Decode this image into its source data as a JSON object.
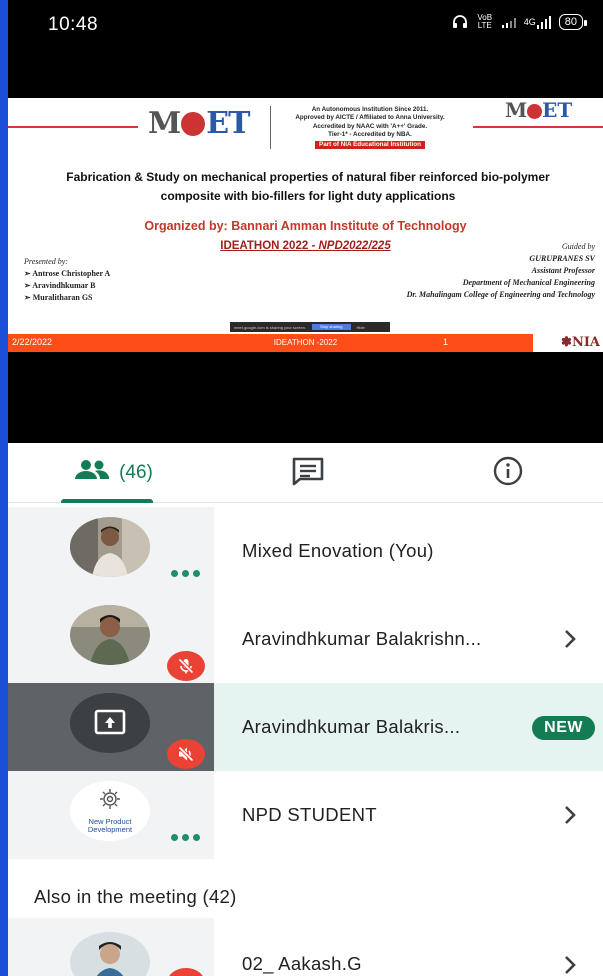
{
  "status_bar": {
    "time": "10:48",
    "icons": [
      "headphones-icon",
      "volte-icon",
      "signal-icon",
      "4g-signal-icon"
    ],
    "volte_text": "VoB LTE",
    "network_text": "4G",
    "battery": "80"
  },
  "slide": {
    "logo_text": "MCET",
    "institution_lines": [
      "An Autonomous Institution Since 2011.",
      "Approved by AICTE / Affiliated to Anna University.",
      "Accredited by NAAC with 'A++' Grade.",
      "Tier-1* - Accredited by NBA."
    ],
    "nia_tag": "Part of NIA Educational Institution",
    "title": "Fabrication & Study on mechanical properties of natural fiber reinforced bio-polymer composite with bio-fillers for light duty applications",
    "organized_by": "Organized by: Bannari Amman Institute of Technology",
    "ideathon_prefix": "IDEATHON 2022 - ",
    "ideathon_code": "NPD2022/225",
    "presented_label": "Presented by:",
    "presenters": [
      "Antrose Christopher A",
      "Aravindhkumar B",
      "Muralitharan GS"
    ],
    "guided_label": "Guided by",
    "guide_name": "GURUPRANES SV",
    "guide_role": "Assistant Professor",
    "guide_dept": "Department of Mechanical Engineering",
    "guide_college": "Dr. Mahalingam College of Engineering and Technology",
    "share_text": "meet.google.com is sharing your screen.",
    "share_button": "Stop sharing",
    "share_hide": "Hide",
    "footer_date": "2/22/2022",
    "footer_center": "IDEATHON -2022",
    "footer_page": "1",
    "footer_logo": "NIA"
  },
  "tabs": {
    "people_count": "(46)",
    "active": "people"
  },
  "participants": [
    {
      "name": "Mixed Enovation (You)",
      "status": "more-options"
    },
    {
      "name": "Aravindhkumar Balakrishn...",
      "status": "muted"
    },
    {
      "name": "Aravindhkumar Balakris...",
      "status": "presenting-muted",
      "badge": "NEW"
    },
    {
      "name": "NPD STUDENT",
      "status": "more-options",
      "avatar_text": "New Product Development"
    }
  ],
  "also_in_meeting": {
    "label": "Also in the meeting (42)",
    "first": {
      "name": "02_ Aakash.G"
    }
  },
  "colors": {
    "accent": "#137c52",
    "mute_red": "#ea4335",
    "footer_orange": "#ff4d1a",
    "frame_blue": "#1b4fd6"
  }
}
